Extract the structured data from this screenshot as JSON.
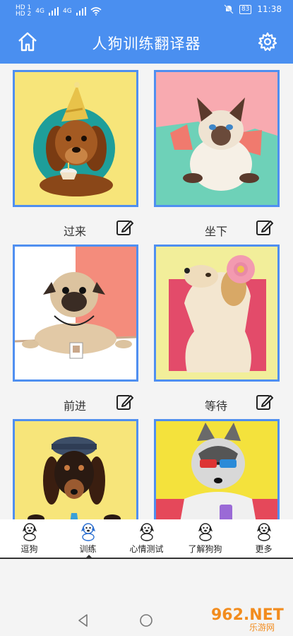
{
  "status": {
    "left_sim1": "HD 1",
    "left_sim2": "HD 2",
    "network1": "4G",
    "network2": "4G",
    "battery": "83",
    "time": "11:38"
  },
  "header": {
    "title": "人狗训练翻译器"
  },
  "cards": [
    {
      "label": "过来"
    },
    {
      "label": "坐下"
    },
    {
      "label": "前进"
    },
    {
      "label": "等待"
    },
    {
      "label": ""
    },
    {
      "label": ""
    }
  ],
  "tabs": [
    {
      "label": "逗狗",
      "active": false
    },
    {
      "label": "训练",
      "active": true
    },
    {
      "label": "心情测试",
      "active": false
    },
    {
      "label": "了解狗狗",
      "active": false
    },
    {
      "label": "更多",
      "active": false
    }
  ],
  "watermark": {
    "brand": "962.NET",
    "sub": "乐游网"
  },
  "colors": {
    "primary": "#4a8ff0",
    "frame": "#4f8ff0",
    "watermark_orange": "#f28c1e"
  }
}
